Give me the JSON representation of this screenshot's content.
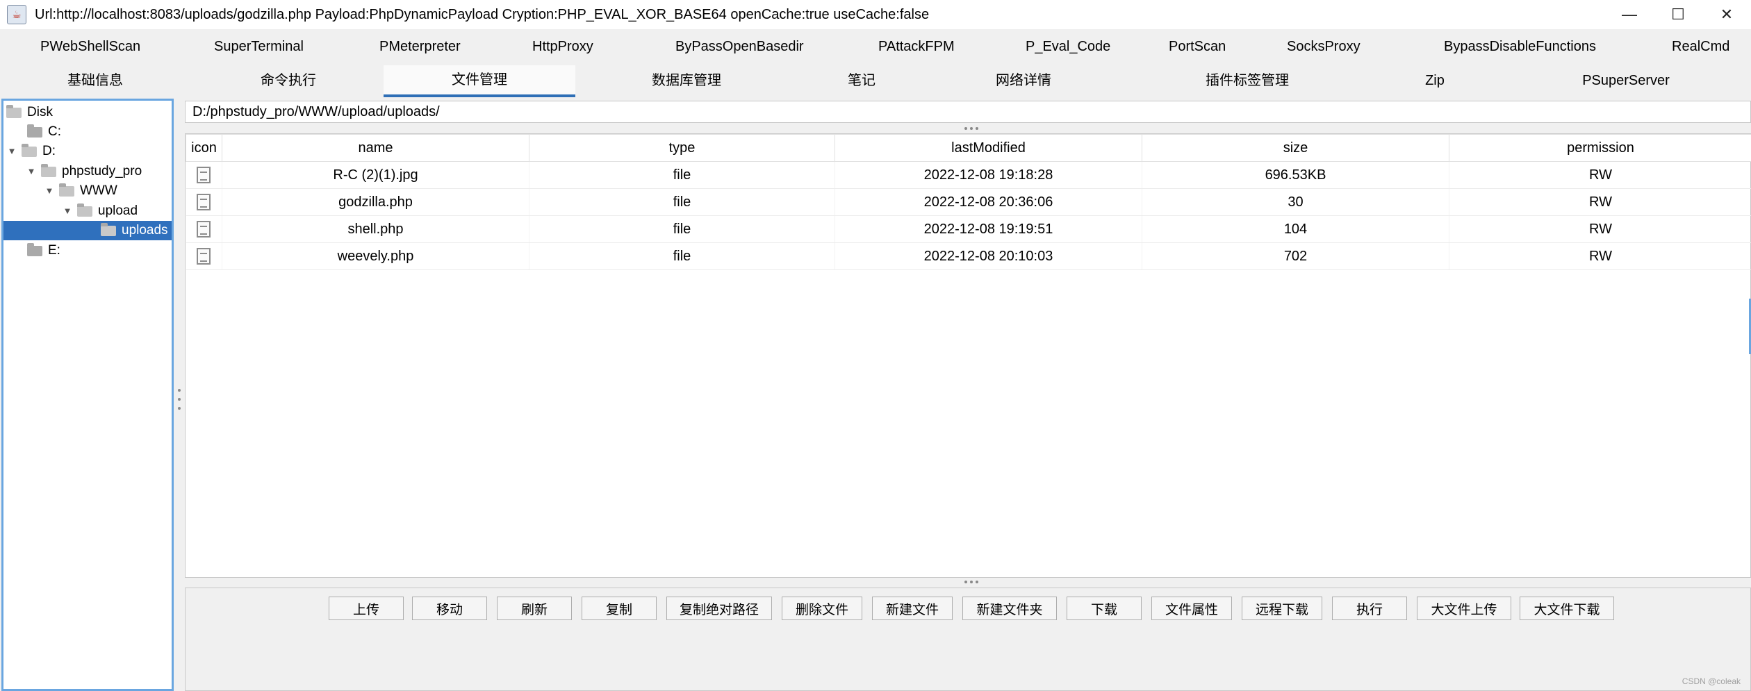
{
  "window": {
    "title": "Url:http://localhost:8083/uploads/godzilla.php Payload:PhpDynamicPayload Cryption:PHP_EVAL_XOR_BASE64 openCache:true useCache:false",
    "minimize": "—",
    "maximize": "☐",
    "close": "✕"
  },
  "plugin_tabs": [
    "PWebShellScan",
    "SuperTerminal",
    "PMeterpreter",
    "HttpProxy",
    "ByPassOpenBasedir",
    "PAttackFPM",
    "P_Eval_Code",
    "PortScan",
    "SocksProxy",
    "BypassDisableFunctions",
    "RealCmd"
  ],
  "main_tabs": [
    "基础信息",
    "命令执行",
    "文件管理",
    "数据库管理",
    "笔记",
    "网络详情",
    "插件标签管理",
    "Zip",
    "PSuperServer"
  ],
  "active_main_tab": "文件管理",
  "tree": [
    "Disk",
    "C:",
    "D:",
    "phpstudy_pro",
    "WWW",
    "upload",
    "uploads",
    "E:"
  ],
  "path": "D:/phpstudy_pro/WWW/upload/uploads/",
  "table": {
    "headers": [
      "icon",
      "name",
      "type",
      "lastModified",
      "size",
      "permission"
    ],
    "rows": [
      [
        "R-C (2)(1).jpg",
        "file",
        "2022-12-08 19:18:28",
        "696.53KB",
        "RW"
      ],
      [
        "godzilla.php",
        "file",
        "2022-12-08 20:36:06",
        "30",
        "RW"
      ],
      [
        "shell.php",
        "file",
        "2022-12-08 19:19:51",
        "104",
        "RW"
      ],
      [
        "weevely.php",
        "file",
        "2022-12-08 20:10:03",
        "702",
        "RW"
      ]
    ]
  },
  "buttons": [
    "上传",
    "移动",
    "刷新",
    "复制",
    "复制绝对路径",
    "删除文件",
    "新建文件",
    "新建文件夹",
    "下载",
    "文件属性",
    "远程下载",
    "执行",
    "大文件上传",
    "大文件下载"
  ],
  "watermark": "CSDN @coleak",
  "colors": {
    "accent": "#2f6fb6",
    "selection": "#2f70bd",
    "panel_border": "#6aa6e0"
  }
}
